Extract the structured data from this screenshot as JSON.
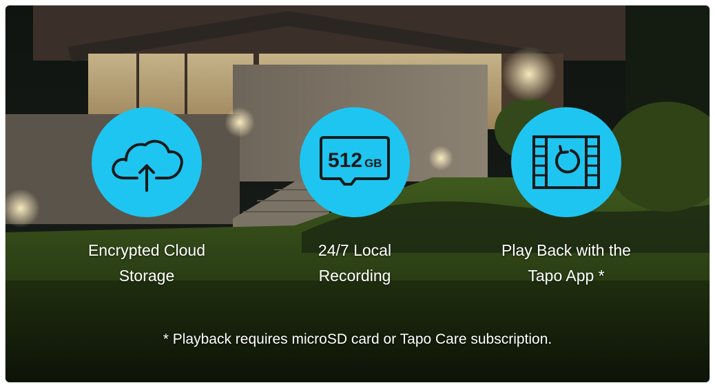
{
  "colors": {
    "accent": "#1ec5f0",
    "icon_stroke": "#1a1a1a",
    "text": "#ffffff"
  },
  "features": [
    {
      "icon": "cloud-upload-icon",
      "label_line1": "Encrypted Cloud",
      "label_line2": "Storage"
    },
    {
      "icon": "microsd-card-icon",
      "card_capacity": "512",
      "card_unit": "GB",
      "label_line1": "24/7 Local",
      "label_line2": "Recording"
    },
    {
      "icon": "video-replay-icon",
      "label_line1": "Play Back with the",
      "label_line2": "Tapo App *"
    }
  ],
  "footnote": "* Playback requires microSD card or Tapo Care subscription."
}
